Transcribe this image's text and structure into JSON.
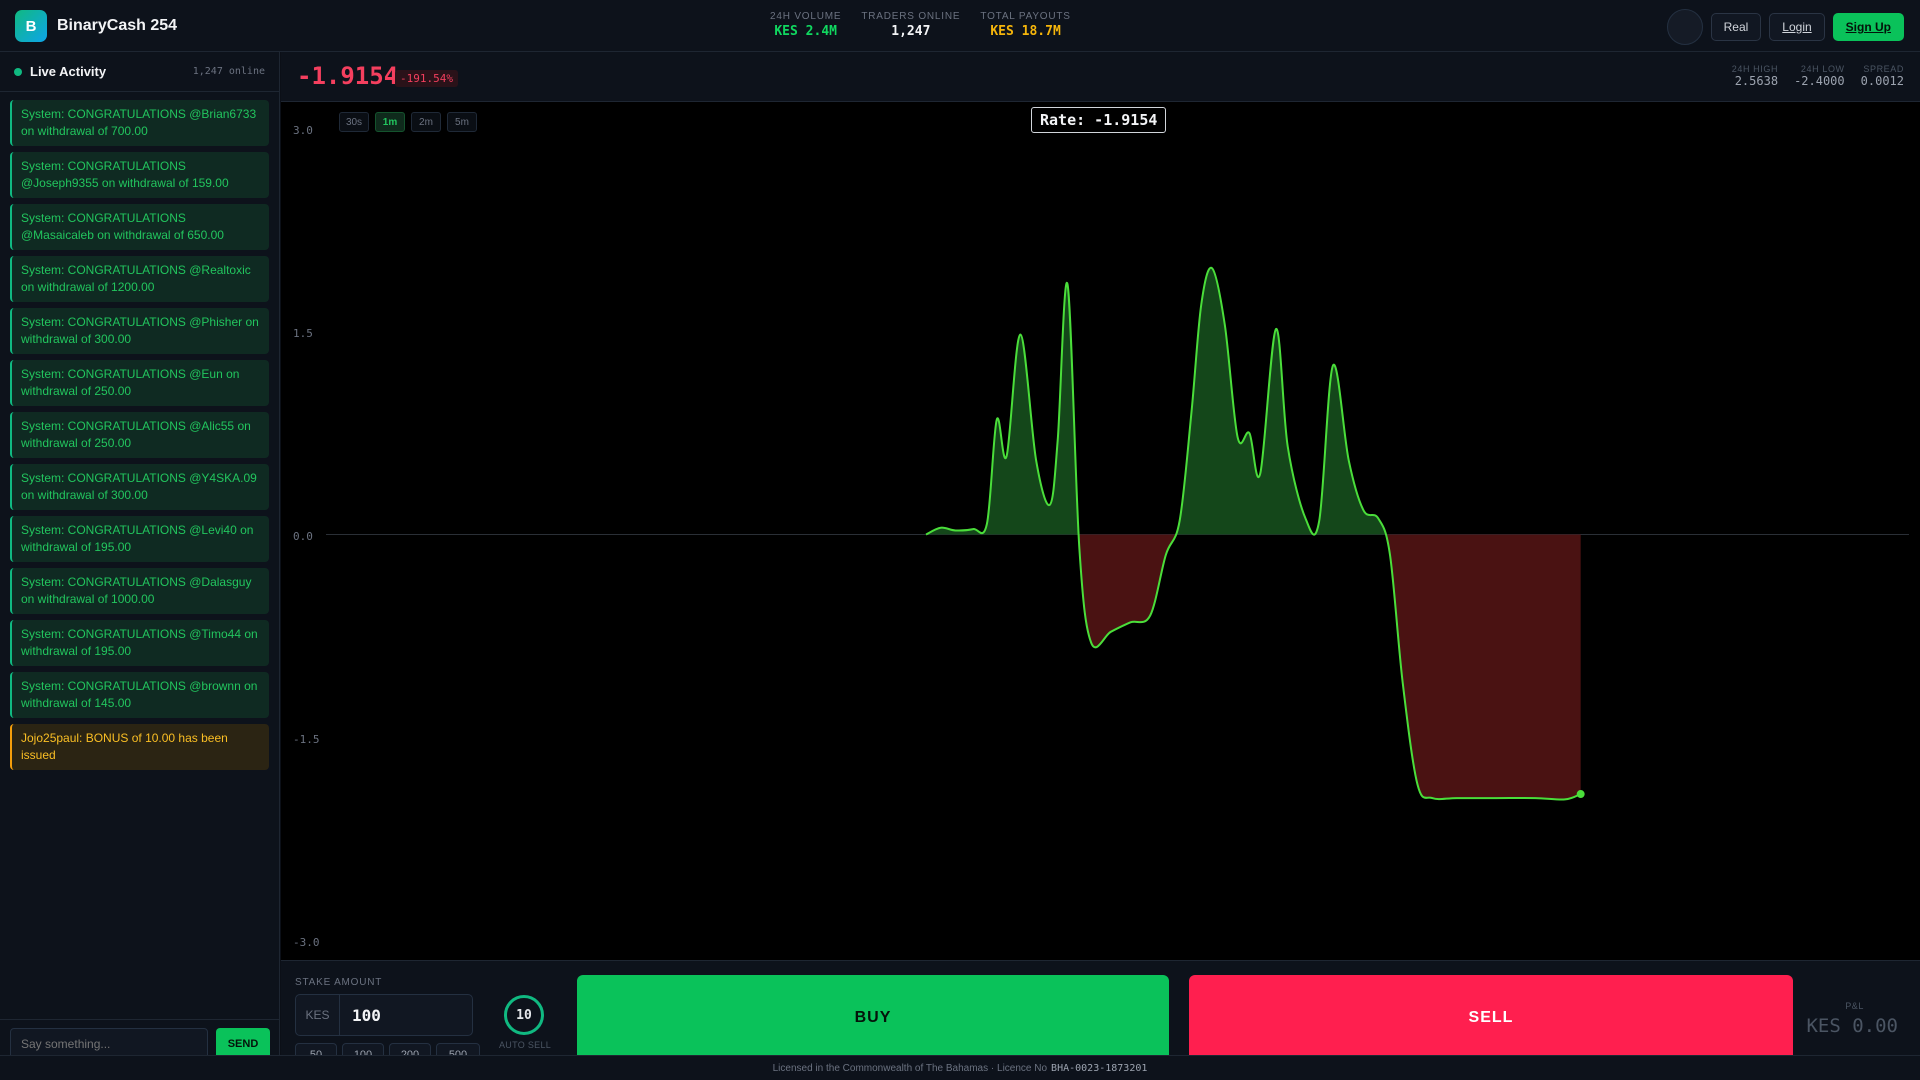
{
  "brand": {
    "logo_letter": "B",
    "name": "BinaryCash 254"
  },
  "header_stats": [
    {
      "label": "24H VOLUME",
      "value": "KES 2.4M",
      "color": "#10d860"
    },
    {
      "label": "TRADERS ONLINE",
      "value": "1,247",
      "color": "#f3f4f6"
    },
    {
      "label": "TOTAL PAYOUTS",
      "value": "KES 18.7M",
      "color": "#f5b50b"
    }
  ],
  "header_actions": {
    "real": "Real",
    "login": "Login",
    "signup": "Sign Up"
  },
  "sidebar": {
    "title": "Live Activity",
    "online": "1,247 online",
    "messages": [
      {
        "text": "System: CONGRATULATIONS @Brian6733 on withdrawal of 700.00",
        "type": "system"
      },
      {
        "text": "System: CONGRATULATIONS @Joseph9355 on withdrawal of 159.00",
        "type": "system"
      },
      {
        "text": "System: CONGRATULATIONS @Masaicaleb on withdrawal of 650.00",
        "type": "system"
      },
      {
        "text": "System: CONGRATULATIONS @Realtoxic on withdrawal of 1200.00",
        "type": "system"
      },
      {
        "text": "System: CONGRATULATIONS @Phisher on withdrawal of 300.00",
        "type": "system"
      },
      {
        "text": "System: CONGRATULATIONS @Eun on withdrawal of 250.00",
        "type": "system"
      },
      {
        "text": "System: CONGRATULATIONS @Alic55 on withdrawal of 250.00",
        "type": "system"
      },
      {
        "text": "System: CONGRATULATIONS @Y4SKA.09 on withdrawal of 300.00",
        "type": "system"
      },
      {
        "text": "System: CONGRATULATIONS @Levi40 on withdrawal of 195.00",
        "type": "system"
      },
      {
        "text": "System: CONGRATULATIONS @Dalasguy on withdrawal of 1000.00",
        "type": "system"
      },
      {
        "text": "System: CONGRATULATIONS @Timo44 on withdrawal of 195.00",
        "type": "system"
      },
      {
        "text": "System: CONGRATULATIONS @brownn on withdrawal of 145.00",
        "type": "system"
      },
      {
        "text": "Jojo25paul: BONUS of 10.00 has been issued",
        "type": "bonus"
      }
    ],
    "chat_placeholder": "Say something...",
    "send_label": "SEND"
  },
  "price": {
    "current": "-1.9154",
    "change": "-191.54%"
  },
  "market_stats": [
    {
      "label": "24H HIGH",
      "value": "2.5638"
    },
    {
      "label": "24H LOW",
      "value": "-2.4000"
    },
    {
      "label": "SPREAD",
      "value": "0.0012"
    }
  ],
  "timeframes": [
    {
      "label": "30s",
      "active": false
    },
    {
      "label": "1m",
      "active": true
    },
    {
      "label": "2m",
      "active": false
    },
    {
      "label": "5m",
      "active": false
    }
  ],
  "rate_label": "Rate: -1.9154",
  "trade": {
    "stake_label": "STAKE AMOUNT",
    "currency": "KES",
    "stake_value": "100",
    "quick_amounts": [
      "50",
      "100",
      "200",
      "500"
    ],
    "timer_value": "10",
    "timer_label": "AUTO SELL",
    "buy_label": "BUY",
    "sell_label": "SELL",
    "pnl_label": "P&L",
    "pnl_value": "KES 0.00"
  },
  "footer": {
    "text": "Licensed in the Commonwealth of The Bahamas · Licence No",
    "licence": "BHA-0023-1873201"
  },
  "colors": {
    "up": "#4ade3a",
    "up_fill": "#14471a",
    "down_fill": "#4a1212",
    "sell": "#ff1f4f",
    "buy": "#0ac25a"
  },
  "chart_data": {
    "type": "area",
    "x_range": [
      0,
      1
    ],
    "ylim": [
      -3.0,
      3.0
    ],
    "yticks": [
      "3.0",
      "1.5",
      "0.0",
      "-1.5",
      "-3.0"
    ],
    "baseline": 0.0,
    "points": [
      [
        0.0,
        0.0
      ],
      [
        0.015,
        0.05
      ],
      [
        0.03,
        0.03
      ],
      [
        0.048,
        0.04
      ],
      [
        0.062,
        0.08
      ],
      [
        0.072,
        0.85
      ],
      [
        0.082,
        0.58
      ],
      [
        0.096,
        1.48
      ],
      [
        0.112,
        0.55
      ],
      [
        0.126,
        0.22
      ],
      [
        0.134,
        0.7
      ],
      [
        0.144,
        1.85
      ],
      [
        0.156,
        -0.1
      ],
      [
        0.168,
        -0.8
      ],
      [
        0.188,
        -0.72
      ],
      [
        0.208,
        -0.65
      ],
      [
        0.228,
        -0.6
      ],
      [
        0.244,
        -0.15
      ],
      [
        0.258,
        0.1
      ],
      [
        0.27,
        0.9
      ],
      [
        0.28,
        1.7
      ],
      [
        0.291,
        1.97
      ],
      [
        0.304,
        1.55
      ],
      [
        0.317,
        0.72
      ],
      [
        0.329,
        0.75
      ],
      [
        0.34,
        0.45
      ],
      [
        0.356,
        1.52
      ],
      [
        0.368,
        0.65
      ],
      [
        0.386,
        0.12
      ],
      [
        0.4,
        0.1
      ],
      [
        0.414,
        1.25
      ],
      [
        0.43,
        0.55
      ],
      [
        0.445,
        0.18
      ],
      [
        0.46,
        0.12
      ],
      [
        0.472,
        -0.15
      ],
      [
        0.485,
        -1.1
      ],
      [
        0.5,
        -1.85
      ],
      [
        0.515,
        -1.95
      ],
      [
        0.54,
        -1.95
      ],
      [
        0.58,
        -1.95
      ],
      [
        0.62,
        -1.95
      ],
      [
        0.65,
        -1.96
      ],
      [
        0.666,
        -1.92
      ]
    ]
  }
}
